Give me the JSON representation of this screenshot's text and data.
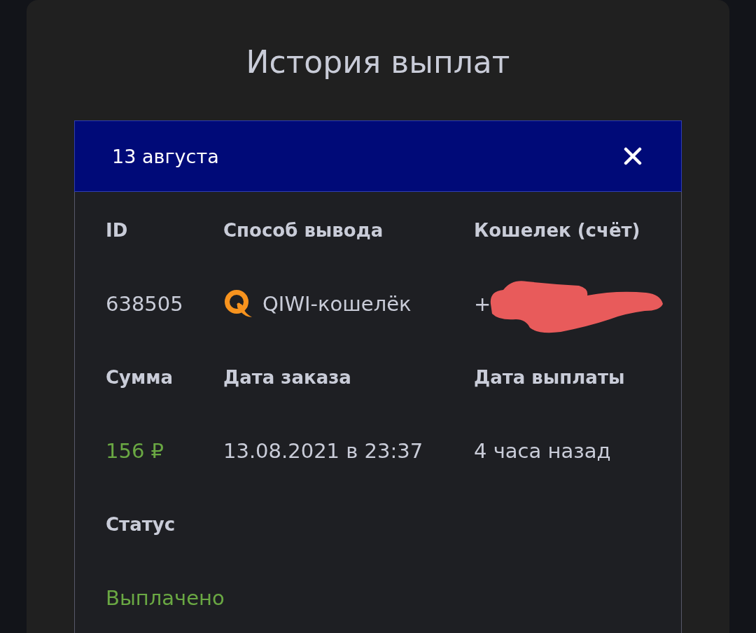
{
  "page": {
    "title": "История выплат"
  },
  "payout": {
    "date": "13 августа",
    "fields": [
      {
        "kind": "text",
        "label": "ID",
        "value": "638505"
      },
      {
        "kind": "method",
        "label": "Способ вывода",
        "value": "QIWI-кошелёк"
      },
      {
        "kind": "wallet",
        "label": "Кошелек (счёт)",
        "value": "+",
        "redacted": true
      },
      {
        "kind": "amount",
        "label": "Сумма",
        "value": "156 ₽"
      },
      {
        "kind": "text",
        "label": "Дата заказа",
        "value": "13.08.2021 в 23:37"
      },
      {
        "kind": "text",
        "label": "Дата выплаты",
        "value": "4 часа назад"
      },
      {
        "kind": "status",
        "label": "Статус",
        "value": "Выплачено"
      }
    ]
  }
}
